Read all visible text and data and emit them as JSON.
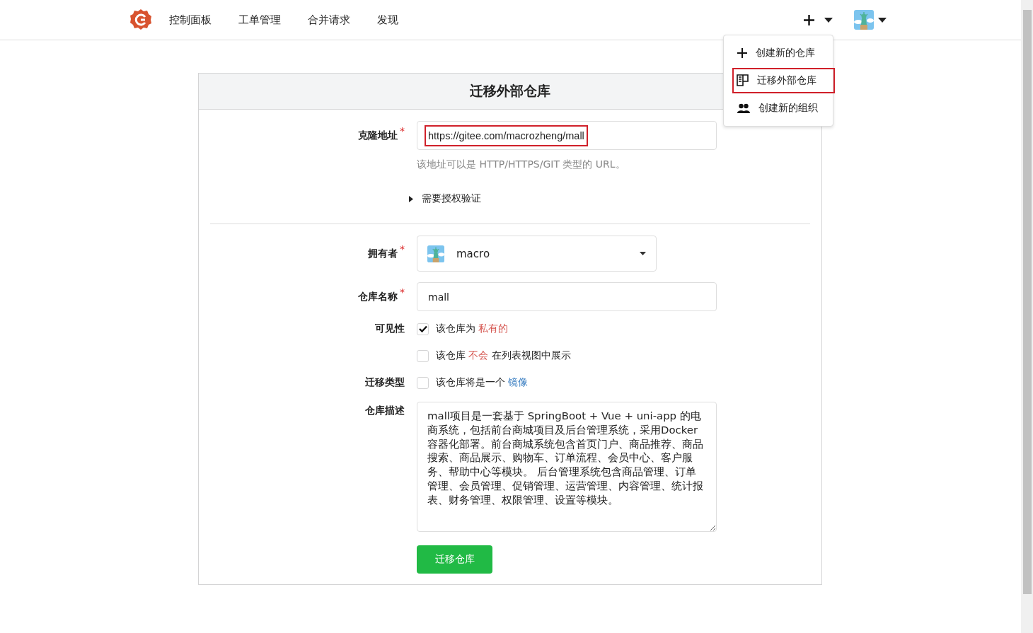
{
  "nav": {
    "items": [
      {
        "label": "控制面板"
      },
      {
        "label": "工单管理"
      },
      {
        "label": "合并请求"
      },
      {
        "label": "发现"
      }
    ]
  },
  "create_menu": {
    "expanded": true,
    "items": [
      {
        "kind": "plus",
        "label": "创建新的仓库",
        "highlighted": false
      },
      {
        "kind": "migrate",
        "label": "迁移外部仓库",
        "highlighted": true
      },
      {
        "kind": "people",
        "label": "创建新的组织",
        "highlighted": false
      }
    ]
  },
  "form": {
    "title": "迁移外部仓库",
    "clone_url": {
      "label": "克隆地址",
      "required_mark": "*",
      "value": "https://gitee.com/macrozheng/mall",
      "highlighted": true,
      "help": "该地址可以是 HTTP/HTTPS/GIT 类型的 URL。"
    },
    "auth": {
      "label": "需要授权验证",
      "expanded": false
    },
    "owner": {
      "label": "拥有者",
      "required_mark": "*",
      "value": "macro"
    },
    "repo_name": {
      "label": "仓库名称",
      "required_mark": "*",
      "value": "mall"
    },
    "options": [
      {
        "label": "可见性",
        "checked": true,
        "parts": [
          {
            "kind": "plain",
            "text": "该仓库为 "
          },
          {
            "kind": "warning",
            "text": "私有的"
          }
        ]
      },
      {
        "checked": false,
        "parts": [
          {
            "kind": "plain",
            "text": "该仓库 "
          },
          {
            "kind": "warning",
            "text": "不会"
          },
          {
            "kind": "plain",
            "text": " 在列表视图中展示"
          }
        ]
      },
      {
        "label": "迁移类型",
        "checked": false,
        "parts": [
          {
            "kind": "plain",
            "text": "该仓库将是一个 "
          },
          {
            "kind": "link",
            "text": "镜像"
          }
        ]
      }
    ],
    "description": {
      "label": "仓库描述",
      "value": "mall项目是一套基于 SpringBoot + Vue + uni-app 的电商系统，包括前台商城项目及后台管理系统，采用Docker容器化部署。前台商城系统包含首页门户、商品推荐、商品搜索、商品展示、购物车、订单流程、会员中心、客户服务、帮助中心等模块。 后台管理系统包含商品管理、订单管理、会员管理、促销管理、运营管理、内容管理、统计报表、财务管理、权限管理、设置等模块。"
    },
    "submit": "迁移仓库"
  }
}
